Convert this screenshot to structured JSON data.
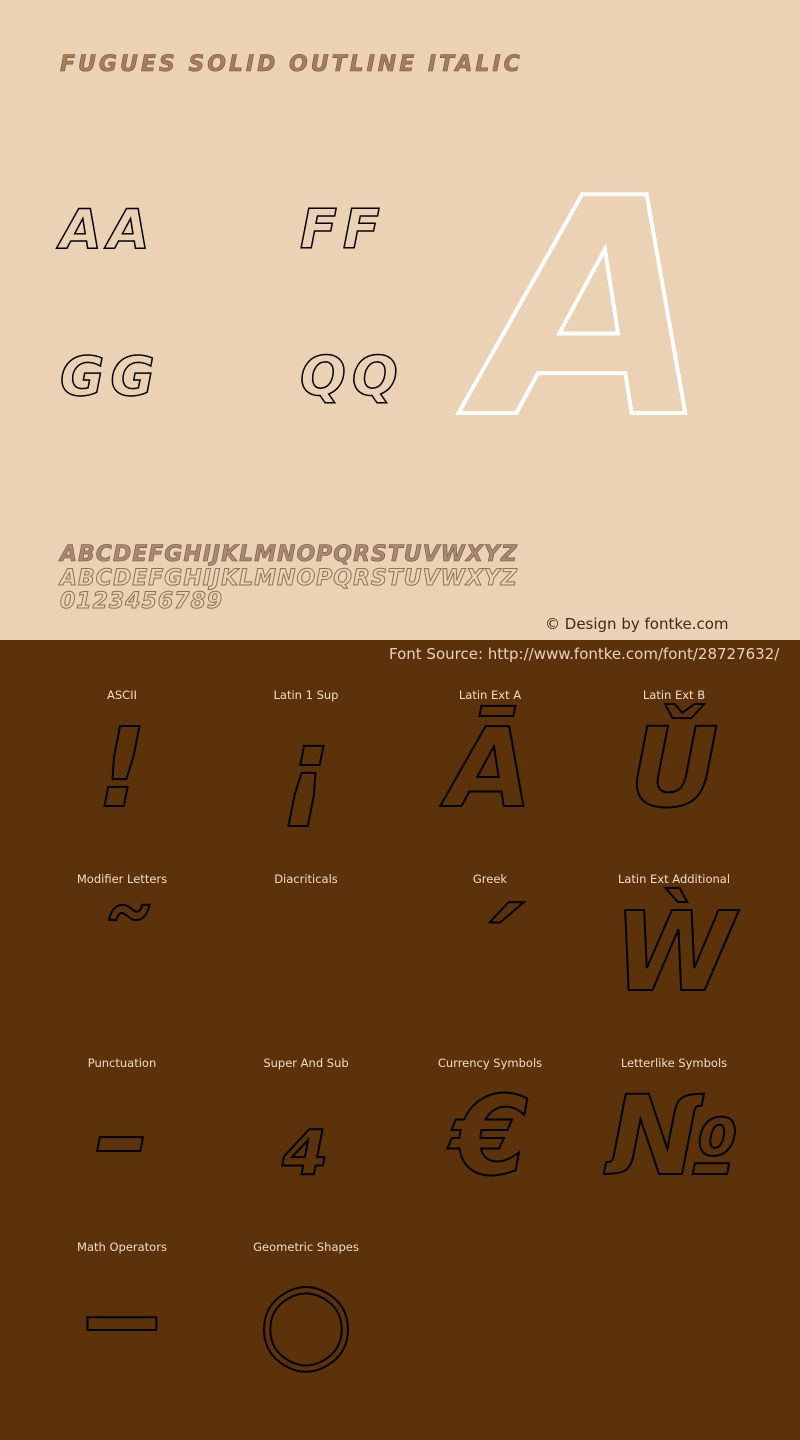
{
  "title": "Fugues Solid Outline Italic",
  "pairs": [
    "Aa",
    "Ff",
    "Gg",
    "Qq"
  ],
  "big_glyph": "a",
  "alphabet_upper": "ABCDEFGHIJKLMNOPQRSTUVWXYZ",
  "alphabet_lower": "abcdefghijklmnopqrstuvwxyz",
  "digits": "0123456789",
  "credit": "© Design by fontke.com",
  "source": "Font Source: http://www.fontke.com/font/28727632/",
  "colors": {
    "top_bg": "#ecd2b4",
    "bottom_bg": "#5c320b"
  },
  "blocks": [
    {
      "label": "ASCII",
      "glyph": "!"
    },
    {
      "label": "Latin 1 Sup",
      "glyph": "¡"
    },
    {
      "label": "Latin Ext A",
      "glyph": "Ā"
    },
    {
      "label": "Latin Ext B",
      "glyph": "Ǔ"
    },
    {
      "label": "Modifier Letters",
      "glyph": "˜"
    },
    {
      "label": "Diacriticals",
      "glyph": ""
    },
    {
      "label": "Greek",
      "glyph": "΄"
    },
    {
      "label": "Latin Ext Additional",
      "glyph": "Ẁ"
    },
    {
      "label": "Punctuation",
      "glyph": "–"
    },
    {
      "label": "Super And Sub",
      "glyph": "₄"
    },
    {
      "label": "Currency Symbols",
      "glyph": "€"
    },
    {
      "label": "Letterlike Symbols",
      "glyph": "№"
    },
    {
      "label": "Math Operators",
      "glyph": "−"
    },
    {
      "label": "Geometric Shapes",
      "glyph": "○"
    }
  ]
}
